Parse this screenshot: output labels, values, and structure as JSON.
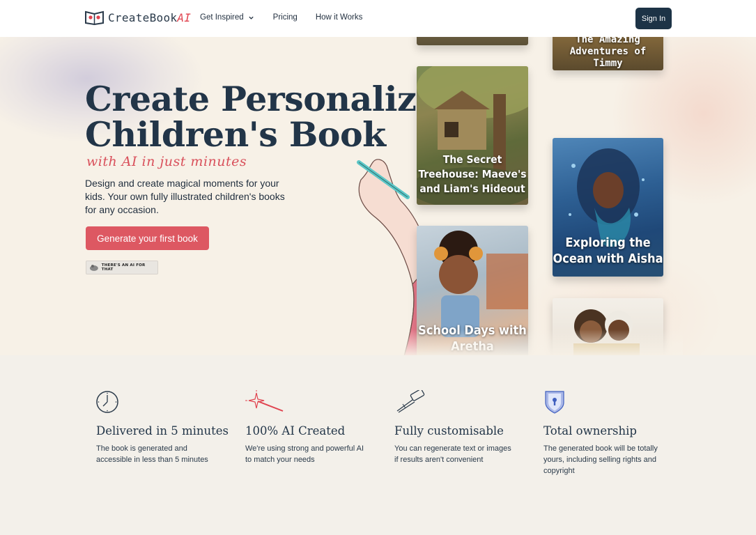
{
  "header": {
    "logo_text": "CreateBook",
    "logo_accent": "AI",
    "nav": [
      {
        "label": "Get Inspired",
        "icon": "chevron-down-icon"
      },
      {
        "label": "Pricing"
      },
      {
        "label": "How it Works"
      }
    ],
    "signin_label": "Sign In"
  },
  "hero": {
    "title_line1": "Create Personalized",
    "title_line2": "Children's Book",
    "subtitle": "with AI in just minutes",
    "description": "Design and create magical moments for your kids. Your own  fully illustrated children's books for any occasion.",
    "cta_label": "Generate your first book",
    "badge_text": "THERE'S AN AI FOR THAT"
  },
  "books": [
    {
      "title": "The Amazing Adventures of Timmy"
    },
    {
      "title": "The Secret Treehouse: Maeve's and Liam's Hideout"
    },
    {
      "title": "Exploring the Ocean with Aisha"
    },
    {
      "title": "School Days with Aretha"
    }
  ],
  "features": [
    {
      "icon": "clock-icon",
      "title": "Delivered in 5 minutes",
      "text": "The book is generated and accessible in less than 5 minutes"
    },
    {
      "icon": "magic-wand-icon",
      "title": "100% AI Created",
      "text": "We're using strong and powerful AI to match your needs"
    },
    {
      "icon": "brush-icon",
      "title": "Fully customisable",
      "text": "You can regenerate text or images if results aren't convenient"
    },
    {
      "icon": "shield-lock-icon",
      "title": "Total ownership",
      "text": "The generated book will be totally yours, including selling rights and copyright"
    }
  ],
  "colors": {
    "brand_dark": "#1d3346",
    "accent_red": "#dd5862",
    "hero_bg": "#f7f1e7",
    "features_bg": "#f3f0ea"
  }
}
